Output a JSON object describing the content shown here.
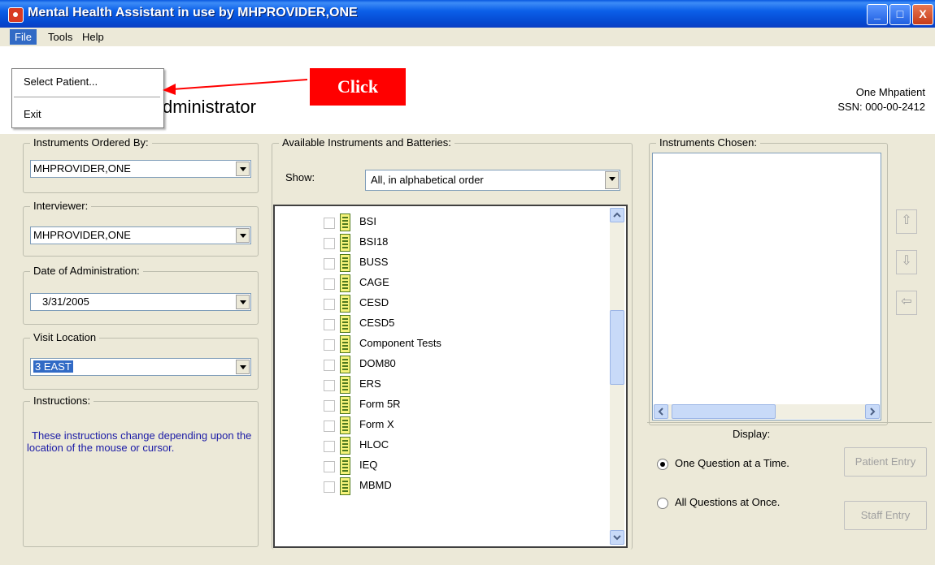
{
  "window": {
    "title": "Mental Health Assistant in use by MHPROVIDER,ONE",
    "controls": {
      "minimize": "_",
      "maximize": "□",
      "close": "X"
    }
  },
  "menubar": {
    "file": "File",
    "tools": "Tools",
    "help": "Help"
  },
  "file_menu": {
    "select_patient": "Select Patient...",
    "exit": "Exit"
  },
  "callout": {
    "text": "Click"
  },
  "header": {
    "title_visible": "dministrator",
    "patient_name": "One Mhpatient",
    "patient_ssn": "SSN: 000-00-2412"
  },
  "left_panel": {
    "ordered_by_label": "Instruments Ordered By:",
    "ordered_by_value": "MHPROVIDER,ONE",
    "interviewer_label": "Interviewer:",
    "interviewer_value": "MHPROVIDER,ONE",
    "date_label": "Date of Administration:",
    "date_value": "3/31/2005",
    "location_label": "Visit Location",
    "location_value": "3 EAST",
    "instructions_label": "Instructions:",
    "instructions_text": "These instructions change depending upon the location of the mouse or cursor."
  },
  "middle_panel": {
    "group_label": "Available Instruments and Batteries:",
    "show_label": "Show:",
    "show_value": "All, in alphabetical order",
    "instruments": [
      "BSI",
      "BSI18",
      "BUSS",
      "CAGE",
      "CESD",
      "CESD5",
      "Component Tests",
      "DOM80",
      "ERS",
      "Form 5R",
      "Form X",
      "HLOC",
      "IEQ",
      "MBMD"
    ]
  },
  "right_panel": {
    "chosen_label": "Instruments Chosen:",
    "display_label": "Display:",
    "one_question": "One Question at a Time.",
    "all_questions": "All Questions at Once.",
    "patient_entry": "Patient Entry",
    "staff_entry": "Staff Entry",
    "selected_mode": "one_question"
  },
  "icons": {
    "move_up": "up-arrow-icon",
    "move_down": "down-arrow-icon",
    "remove": "left-arrow-icon"
  }
}
